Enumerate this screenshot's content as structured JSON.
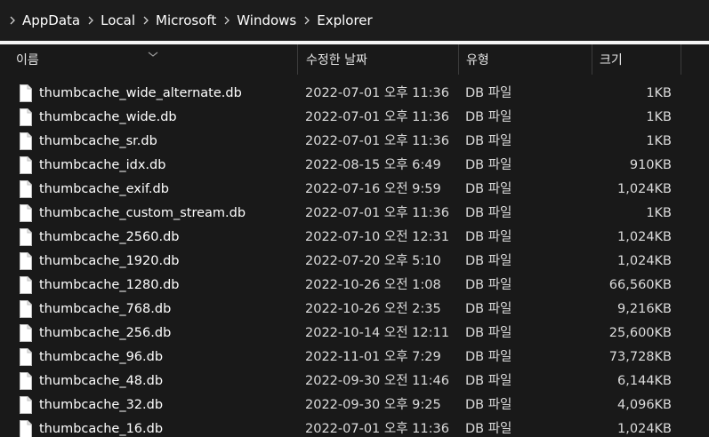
{
  "breadcrumb": {
    "items": [
      "AppData",
      "Local",
      "Microsoft",
      "Windows",
      "Explorer"
    ]
  },
  "columns": {
    "name": "이름",
    "date": "수정한 날짜",
    "type": "유형",
    "size": "크기"
  },
  "files": [
    {
      "name": "thumbcache_wide_alternate.db",
      "date": "2022-07-01 오후 11:36",
      "type": "DB 파일",
      "size": "1KB"
    },
    {
      "name": "thumbcache_wide.db",
      "date": "2022-07-01 오후 11:36",
      "type": "DB 파일",
      "size": "1KB"
    },
    {
      "name": "thumbcache_sr.db",
      "date": "2022-07-01 오후 11:36",
      "type": "DB 파일",
      "size": "1KB"
    },
    {
      "name": "thumbcache_idx.db",
      "date": "2022-08-15 오후 6:49",
      "type": "DB 파일",
      "size": "910KB"
    },
    {
      "name": "thumbcache_exif.db",
      "date": "2022-07-16 오전 9:59",
      "type": "DB 파일",
      "size": "1,024KB"
    },
    {
      "name": "thumbcache_custom_stream.db",
      "date": "2022-07-01 오후 11:36",
      "type": "DB 파일",
      "size": "1KB"
    },
    {
      "name": "thumbcache_2560.db",
      "date": "2022-07-10 오전 12:31",
      "type": "DB 파일",
      "size": "1,024KB"
    },
    {
      "name": "thumbcache_1920.db",
      "date": "2022-07-20 오후 5:10",
      "type": "DB 파일",
      "size": "1,024KB"
    },
    {
      "name": "thumbcache_1280.db",
      "date": "2022-10-26 오전 1:08",
      "type": "DB 파일",
      "size": "66,560KB"
    },
    {
      "name": "thumbcache_768.db",
      "date": "2022-10-26 오전 2:35",
      "type": "DB 파일",
      "size": "9,216KB"
    },
    {
      "name": "thumbcache_256.db",
      "date": "2022-10-14 오전 12:11",
      "type": "DB 파일",
      "size": "25,600KB"
    },
    {
      "name": "thumbcache_96.db",
      "date": "2022-11-01 오후 7:29",
      "type": "DB 파일",
      "size": "73,728KB"
    },
    {
      "name": "thumbcache_48.db",
      "date": "2022-09-30 오전 11:46",
      "type": "DB 파일",
      "size": "6,144KB"
    },
    {
      "name": "thumbcache_32.db",
      "date": "2022-09-30 오후 9:25",
      "type": "DB 파일",
      "size": "4,096KB"
    },
    {
      "name": "thumbcache_16.db",
      "date": "2022-07-01 오후 11:36",
      "type": "DB 파일",
      "size": "1,024KB"
    }
  ],
  "icons": {
    "breadcrumb_separator": "chevron-right-icon",
    "file": "file-icon",
    "sort": "chevron-down-icon"
  },
  "colors": {
    "background": "#191919",
    "address_bar": "#1c1c1c",
    "text": "#ffffff"
  }
}
